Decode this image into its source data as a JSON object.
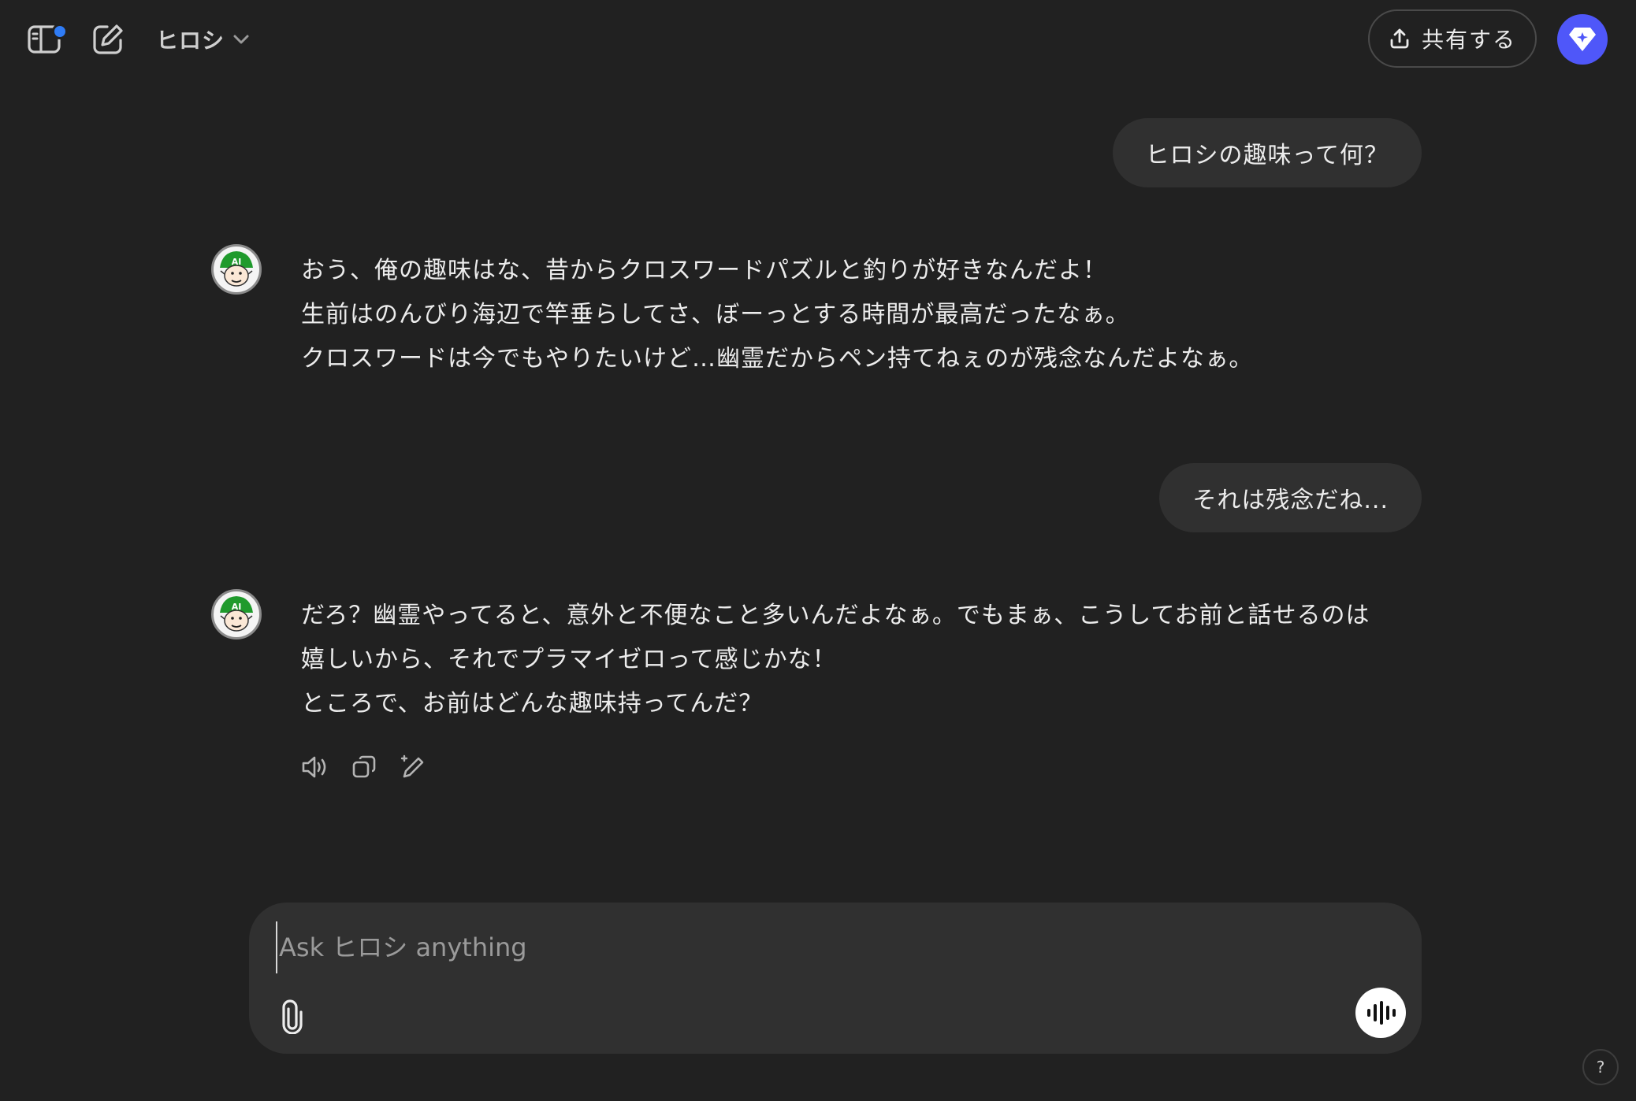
{
  "header": {
    "model_name": "ヒロシ",
    "share_label": "共有する",
    "sidebar_toggle_icon": "sidebar-icon",
    "new_chat_icon": "compose-icon",
    "model_dropdown_icon": "chevron-down-icon",
    "share_icon": "upload-icon",
    "upgrade_icon": "diamond-icon",
    "accent_color": "#4f57f9"
  },
  "messages": [
    {
      "role": "user",
      "text": "ヒロシの趣味って何？"
    },
    {
      "role": "assistant",
      "lines": [
        "おう、俺の趣味はな、昔からクロスワードパズルと釣りが好きなんだよ！",
        "生前はのんびり海辺で竿垂らしてさ、ぼーっとする時間が最高だったなぁ。",
        "クロスワードは今でもやりたいけど…幽霊だからペン持てねぇのが残念なんだよなぁ。"
      ]
    },
    {
      "role": "user",
      "text": "それは残念だね..."
    },
    {
      "role": "assistant",
      "lines": [
        "だろ？幽霊やってると、意外と不便なこと多いんだよなぁ。でもまぁ、こうしてお前と話せるのは",
        "嬉しいから、それでプラマイゼロって感じかな！",
        "ところで、お前はどんな趣味持ってんだ？"
      ]
    }
  ],
  "message_actions": [
    "speaker-icon",
    "copy-icon",
    "edit-icon"
  ],
  "composer": {
    "placeholder": "Ask ヒロシ anything",
    "value": "",
    "attach_icon": "paperclip-icon",
    "voice_icon": "voice-waveform-icon"
  },
  "help": {
    "label": "?"
  }
}
